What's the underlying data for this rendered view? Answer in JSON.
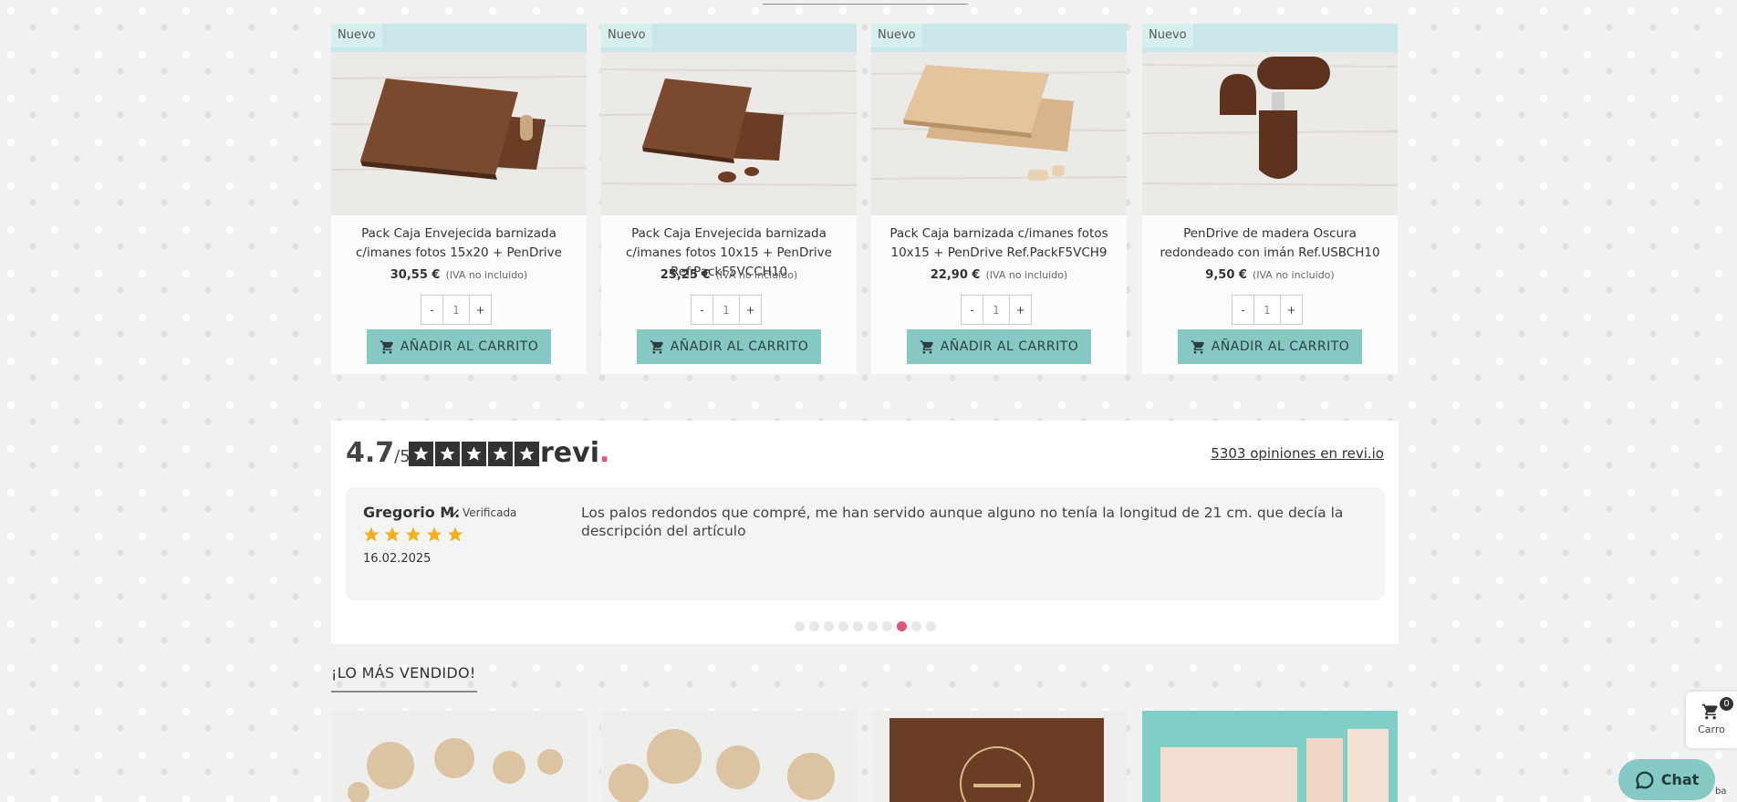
{
  "products": [
    {
      "badge": "Nuevo",
      "name": "Pack Caja Envejecida barnizada c/imanes fotos 15x20 + PenDrive",
      "price": "30,55 €",
      "iva": "(IVA no incluido)",
      "qty": "1",
      "minus": "-",
      "plus": "+",
      "button": "AÑADIR AL CARRITO",
      "image": "dark-wood-box-with-pendrive"
    },
    {
      "badge": "Nuevo",
      "name": "Pack Caja Envejecida barnizada c/imanes fotos 10x15 + PenDrive Ref.PackF5VCCH10",
      "price": "25,25 €",
      "iva": "(IVA no incluido)",
      "qty": "1",
      "minus": "-",
      "plus": "+",
      "button": "AÑADIR AL CARRITO",
      "image": "small-dark-wood-box-with-pendrive"
    },
    {
      "badge": "Nuevo",
      "name": "Pack Caja barnizada c/imanes fotos 10x15 + PenDrive Ref.PackF5VCH9",
      "price": "22,90 €",
      "iva": "(IVA no incluido)",
      "qty": "1",
      "minus": "-",
      "plus": "+",
      "button": "AÑADIR AL CARRITO",
      "image": "light-wood-box-with-pendrive"
    },
    {
      "badge": "Nuevo",
      "name": "PenDrive de madera Oscura redondeado con imán Ref.USBCH10",
      "price": "9,50 €",
      "iva": "(IVA no incluido)",
      "qty": "1",
      "minus": "-",
      "plus": "+",
      "button": "AÑADIR AL CARRITO",
      "image": "dark-wood-usb-pendrive"
    }
  ],
  "reviews": {
    "score": "4.7",
    "score_max": "/5",
    "brand": "revi",
    "brand_dot": ".",
    "count_link": "5303 opiniones en revi.io",
    "review": {
      "author": "Gregorio M.",
      "verified": "Verificada",
      "rating": 5,
      "date": "16.02.2025",
      "text": "Los palos redondos que compré, me han servido aunque alguno no tenía la longitud de 21 cm. que decía la descripción del artículo"
    },
    "slides_total": 10,
    "slide_active": 8
  },
  "best_sellers": {
    "title": "¡LO MÁS VENDIDO!",
    "images": [
      "wooden-balls",
      "large-wooden-balls",
      "engraved-wooden-box",
      "pink-wooden-boxes"
    ]
  },
  "cart": {
    "count": "0",
    "label": "Carro"
  },
  "chat": {
    "label": "Chat",
    "extra": "ba"
  },
  "colors": {
    "accent": "#86c8c4",
    "badge": "#d8eff0",
    "revi_dot": "#e0567a",
    "star": "#f2b01e"
  }
}
